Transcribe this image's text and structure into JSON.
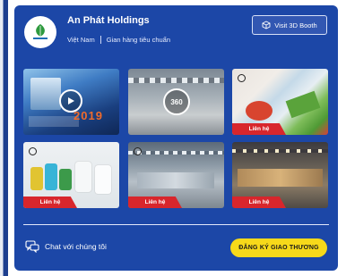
{
  "company": {
    "name": "An Phát Holdings",
    "country": "Việt Nam",
    "package": "Gian hàng tiêu chuẩn"
  },
  "header": {
    "booth_button_label": "Visit 3D Booth"
  },
  "media": [
    {
      "type": "video",
      "overlay_text": "2019"
    },
    {
      "type": "360",
      "badge": "360"
    },
    {
      "type": "image",
      "tag": "Liên hệ"
    },
    {
      "type": "image",
      "tag": "Liên hệ"
    },
    {
      "type": "image",
      "tag": "Liên hệ"
    },
    {
      "type": "image",
      "tag": "Liên hệ"
    }
  ],
  "footer": {
    "chat_label": "Chat với chúng tôi",
    "register_label": "ĐĂNG KÝ GIAO THƯƠNG"
  },
  "colors": {
    "card_background": "#1c47a7",
    "contact_tag": "#d8262c",
    "register_button": "#f7d91a"
  }
}
